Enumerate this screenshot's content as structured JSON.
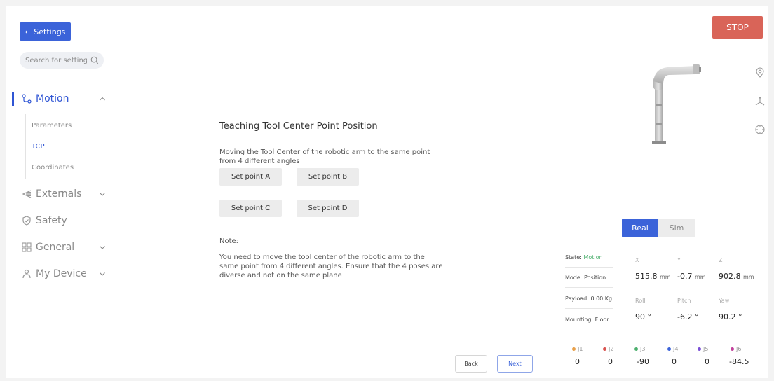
{
  "sidebar": {
    "back_label": "← Settings",
    "search_placeholder": "Search for settings",
    "items": [
      {
        "label": "Motion",
        "icon": "motion-path-icon",
        "active": true
      },
      {
        "label": "Externals",
        "icon": "externals-icon"
      },
      {
        "label": "Safety",
        "icon": "shield-icon"
      },
      {
        "label": "General",
        "icon": "grid-icon"
      },
      {
        "label": "My Device",
        "icon": "user-icon"
      }
    ],
    "sub_items": [
      {
        "label": "Parameters"
      },
      {
        "label": "TCP",
        "active": true
      },
      {
        "label": "Coordinates"
      }
    ]
  },
  "main": {
    "title": "Teaching Tool Center Point Position",
    "description": "Moving the Tool Center of the robotic arm to the same point from 4 different angles",
    "buttons": [
      "Set point A",
      "Set point B",
      "Set point C",
      "Set point D"
    ],
    "note_label": "Note:",
    "note_text": "You need to move the tool center of the robotic arm to the same point from 4 different angles. Ensure that the 4 poses are diverse and not on the same plane",
    "back_label": "Back",
    "next_label": "Next"
  },
  "robot_panel": {
    "stop_label": "STOP",
    "toggle": {
      "real": "Real",
      "sim": "Sim",
      "selected": "Real"
    },
    "state_label": "State:",
    "state_value": "Motion",
    "mode_text": "Mode: Position",
    "payload_text": "Payload: 0.00 Kg",
    "mounting_text": "Mounting: Floor",
    "position": {
      "x_label": "X",
      "x_value": "515.8",
      "x_unit": "mm",
      "y_label": "Y",
      "y_value": "-0.7",
      "y_unit": "mm",
      "z_label": "Z",
      "z_value": "902.8",
      "z_unit": "mm"
    },
    "orientation": {
      "roll_label": "Roll",
      "roll_value": "90 °",
      "pitch_label": "Pitch",
      "pitch_value": "-6.2 °",
      "yaw_label": "Yaw",
      "yaw_value": "90.2 °"
    },
    "joints": [
      {
        "label": "J1",
        "value": "0",
        "color": "#e8a04a"
      },
      {
        "label": "J2",
        "value": "0",
        "color": "#d9534f"
      },
      {
        "label": "J3",
        "value": "-90",
        "color": "#4caf6d"
      },
      {
        "label": "J4",
        "value": "0",
        "color": "#3b63d9"
      },
      {
        "label": "J5",
        "value": "0",
        "color": "#7a4fd6"
      },
      {
        "label": "J6",
        "value": "-84.5",
        "color": "#c2409c"
      }
    ],
    "side_icons": [
      "location-pin-icon",
      "axes-icon",
      "crosshair-icon"
    ],
    "colors": {
      "accent": "#3b63d9",
      "stop": "#d96458",
      "state": "#4caf6d"
    }
  }
}
